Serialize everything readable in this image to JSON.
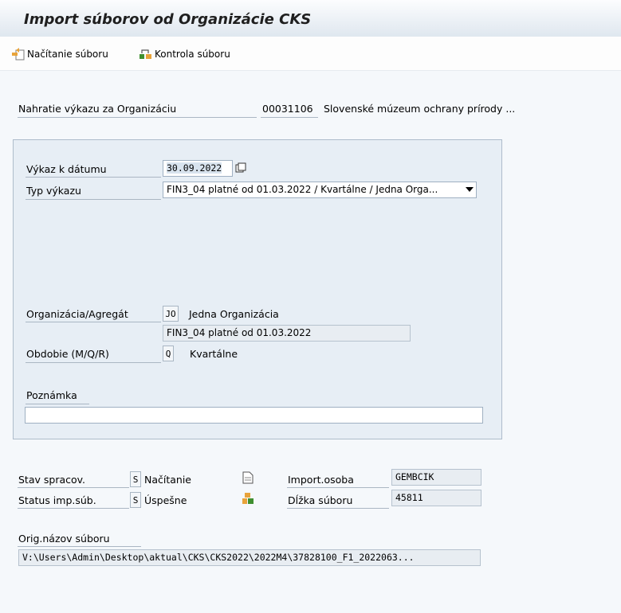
{
  "title": "Import súborov od Organizácie CKS",
  "toolbar": {
    "load_label": "Načítanie súboru",
    "check_label": "Kontrola súboru"
  },
  "org": {
    "label": "Nahratie výkazu za Organizáciu",
    "id": "00031106",
    "name": "Slovenské múzeum ochrany prírody ..."
  },
  "form": {
    "date_label": "Výkaz k dátumu",
    "date_value": "30.09.2022",
    "type_label": "Typ výkazu",
    "type_value": "FIN3_04 platné od 01.03.2022 / Kvartálne / Jedna Orga...",
    "org_agg_label": "Organizácia/Agregát",
    "org_agg_code": "JO",
    "org_agg_text": "Jedna Organizácia",
    "form_desc": "FIN3_04 platné od 01.03.2022",
    "period_label": "Obdobie (M/Q/R)",
    "period_code": "Q",
    "period_text": "Kvartálne",
    "note_label": "Poznámka",
    "note_value": ""
  },
  "status": {
    "proc_label": "Stav spracov.",
    "proc_code": "S",
    "proc_text": "Načítanie",
    "imp_label": "Status imp.súb.",
    "imp_code": "S",
    "imp_text": "Úspešne",
    "person_label": "Import.osoba",
    "person_value": "GEMBCIK",
    "size_label": "Dĺžka súboru",
    "size_value": "45811"
  },
  "file": {
    "label": "Orig.názov súboru",
    "value": "V:\\Users\\Admin\\Desktop\\aktual\\CKS\\CKS2022\\2022M4\\37828100_F1_2022063..."
  },
  "colors": {
    "panel_bg": "#e7eef5",
    "field_border": "#9fb0c2",
    "icon_orange": "#e8a33a",
    "icon_green": "#3f8f2f"
  },
  "icons": [
    "load-file-icon",
    "check-file-icon",
    "calendar-help-icon",
    "dropdown-arrow-icon",
    "document-icon",
    "status-objects-icon"
  ]
}
